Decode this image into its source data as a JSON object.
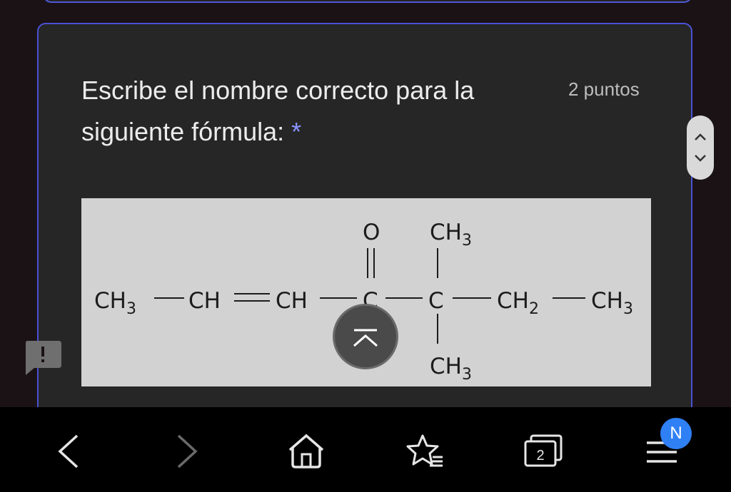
{
  "question": {
    "text": "Escribe el nombre correcto para la siguiente fórmula:",
    "required_mark": "*",
    "points": "2 puntos"
  },
  "formula": {
    "chain": [
      "CH",
      "CH",
      "CH",
      "C",
      "C",
      "CH",
      "CH"
    ],
    "subscript": "3",
    "ch2_subscript": "2",
    "oxygen": "O",
    "methyl": "CH"
  },
  "bottom_nav": {
    "tab_count": "2",
    "menu_badge": "N"
  },
  "icons": {
    "scroll": [
      "chevron-up-icon",
      "chevron-down-icon"
    ],
    "feedback": "feedback-icon",
    "back_to_top": "back-to-top-icon",
    "nav": [
      "back-arrow-icon",
      "forward-arrow-icon",
      "home-icon",
      "star-list-icon",
      "tabs-icon",
      "menu-icon"
    ]
  },
  "colors": {
    "accent": "#4a52d6",
    "required": "#8b93ff",
    "badge": "#2f80f5"
  }
}
